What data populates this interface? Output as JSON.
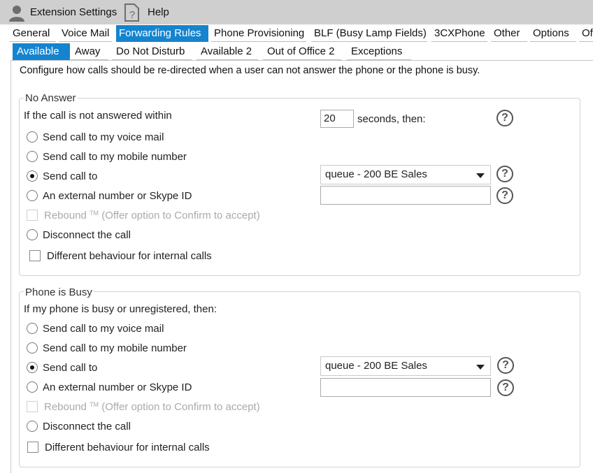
{
  "toolbar": {
    "title": "Extension Settings",
    "help": "Help"
  },
  "tabs": [
    "General",
    "Voice Mail",
    "Forwarding Rules",
    "Phone Provisioning",
    "BLF (Busy Lamp Fields)",
    "3CXPhone",
    "Other",
    "Options",
    "Of"
  ],
  "subtabs": [
    "Available",
    "Away",
    "Do Not Disturb",
    "Available 2",
    "Out of Office 2",
    "Exceptions"
  ],
  "description": "Configure how calls should be re-directed when a user can not answer the phone or the phone is busy.",
  "no_answer": {
    "legend": "No Answer",
    "prompt": "If the call is not answered within",
    "seconds_value": "20",
    "seconds_suffix": "seconds, then:",
    "options": [
      "Send call to my voice mail",
      "Send call to my mobile number",
      "Send call to",
      "An external number or Skype ID"
    ],
    "selected": "Send call to",
    "send_to_value": "queue - 200 BE Sales",
    "rebound_label": "Rebound",
    "rebound_tm": "TM",
    "rebound_note": "(Offer option to Confirm to accept)",
    "disconnect": "Disconnect the call",
    "internal": "Different behaviour for internal calls"
  },
  "busy": {
    "legend": "Phone is Busy",
    "prompt": "If my phone is busy or unregistered, then:",
    "options": [
      "Send call to my voice mail",
      "Send call to my mobile number",
      "Send call to",
      "An external number or Skype ID"
    ],
    "selected": "Send call to",
    "send_to_value": "queue - 200 BE Sales",
    "rebound_label": "Rebound",
    "rebound_tm": "TM",
    "rebound_note": "(Offer option to Confirm to accept)",
    "disconnect": "Disconnect the call",
    "internal": "Different behaviour for internal calls"
  },
  "help_glyph": "?"
}
